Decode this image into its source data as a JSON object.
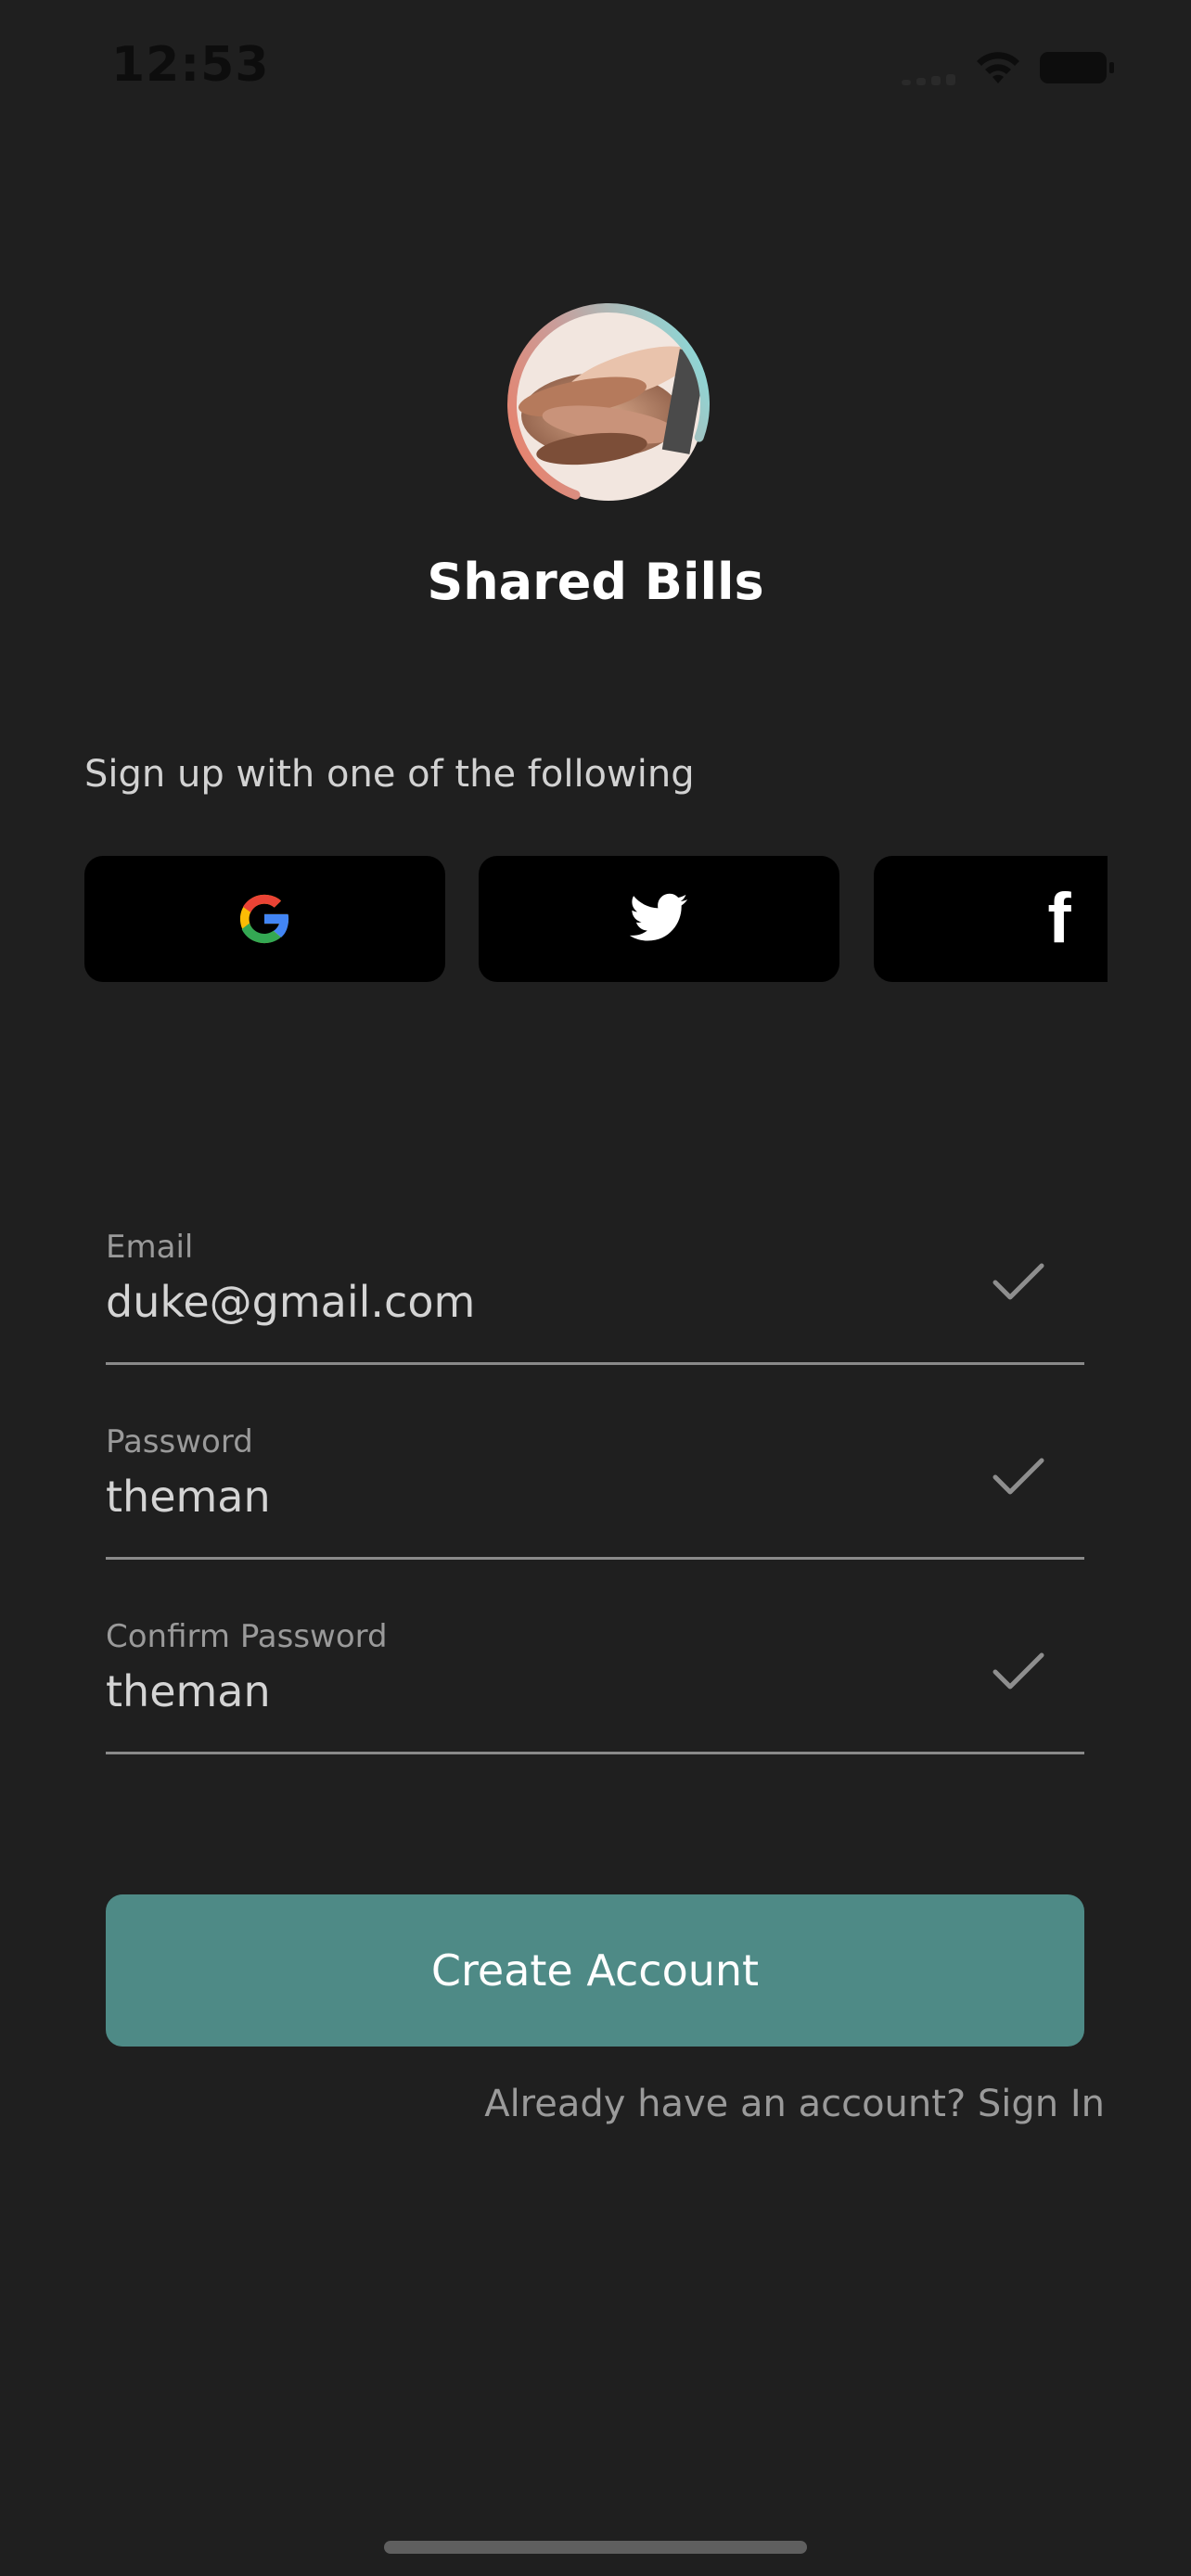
{
  "status_bar": {
    "time": "12:53"
  },
  "app": {
    "title": "Shared Bills",
    "logo_icon": "hands-together-logo"
  },
  "social": {
    "hint": "Sign up with one of the following",
    "buttons": [
      {
        "provider": "google",
        "icon": "google-icon"
      },
      {
        "provider": "twitter",
        "icon": "twitter-bird-icon"
      },
      {
        "provider": "facebook",
        "icon": "facebook-icon",
        "glyph": "f"
      }
    ]
  },
  "form": {
    "email": {
      "label": "Email",
      "value": "duke@gmail.com",
      "valid": true
    },
    "password": {
      "label": "Password",
      "value": "theman",
      "valid": true
    },
    "confirm_password": {
      "label": "Confirm Password",
      "value": "theman",
      "valid": true
    }
  },
  "actions": {
    "create_account": "Create Account",
    "sign_in_prompt": "Already have an account? Sign In"
  },
  "colors": {
    "background": "#1f1f1f",
    "primary_button": "#4e8a86",
    "social_button": "#000000",
    "field_underline": "#8a8a8a",
    "logo_ring_start": "#f07a5f",
    "logo_ring_end": "#7ee6e6"
  }
}
